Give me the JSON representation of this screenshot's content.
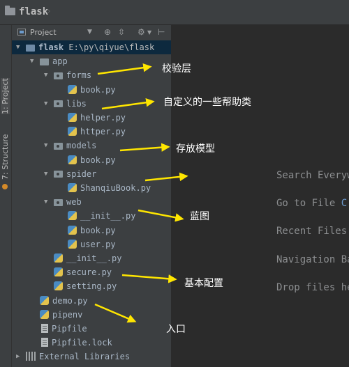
{
  "breadcrumb": {
    "title": "flask"
  },
  "tool_windows": {
    "project_tab": "1: Project",
    "structure_tab": "7: Structure"
  },
  "project_panel": {
    "view_label": "Project",
    "toolbar_icons": [
      "chevron-down-icon",
      "target-icon",
      "collapse-icon",
      "gear-icon",
      "hide-icon"
    ]
  },
  "tree": [
    {
      "label": "flask",
      "path": "E:\\py\\qiyue\\flask",
      "depth": 0,
      "type": "project",
      "expanded": true
    },
    {
      "label": "app",
      "depth": 1,
      "type": "folder",
      "expanded": true
    },
    {
      "label": "forms",
      "depth": 2,
      "type": "package",
      "expanded": true
    },
    {
      "label": "book.py",
      "depth": 3,
      "type": "python"
    },
    {
      "label": "libs",
      "depth": 2,
      "type": "package",
      "expanded": true
    },
    {
      "label": "helper.py",
      "depth": 3,
      "type": "python"
    },
    {
      "label": "httper.py",
      "depth": 3,
      "type": "python"
    },
    {
      "label": "models",
      "depth": 2,
      "type": "package",
      "expanded": true
    },
    {
      "label": "book.py",
      "depth": 3,
      "type": "python"
    },
    {
      "label": "spider",
      "depth": 2,
      "type": "package",
      "expanded": true
    },
    {
      "label": "ShanqiuBook.py",
      "depth": 3,
      "type": "python"
    },
    {
      "label": "web",
      "depth": 2,
      "type": "package",
      "expanded": true
    },
    {
      "label": "__init__.py",
      "depth": 3,
      "type": "python"
    },
    {
      "label": "book.py",
      "depth": 3,
      "type": "python"
    },
    {
      "label": "user.py",
      "depth": 3,
      "type": "python"
    },
    {
      "label": "__init__.py",
      "depth": 2,
      "type": "python"
    },
    {
      "label": "secure.py",
      "depth": 2,
      "type": "python"
    },
    {
      "label": "setting.py",
      "depth": 2,
      "type": "python"
    },
    {
      "label": "demo.py",
      "depth": 1,
      "type": "python"
    },
    {
      "label": "pipenv",
      "depth": 1,
      "type": "python"
    },
    {
      "label": "Pipfile",
      "depth": 1,
      "type": "file"
    },
    {
      "label": "Pipfile.lock",
      "depth": 1,
      "type": "file"
    },
    {
      "label": "External Libraries",
      "depth": 0,
      "type": "library",
      "expanded": false
    }
  ],
  "editor_hints": [
    {
      "text": "Search Everyw"
    },
    {
      "text": "Go to File",
      "key": "C"
    },
    {
      "text": "Recent Files"
    },
    {
      "text": "Navigation Ba"
    },
    {
      "text": "Drop files he"
    }
  ],
  "annotations": [
    {
      "text": "校验层"
    },
    {
      "text": "自定义的一些帮助类"
    },
    {
      "text": "存放模型"
    },
    {
      "text": ""
    },
    {
      "text": "蓝图"
    },
    {
      "text": "基本配置"
    },
    {
      "text": "入口"
    }
  ],
  "colors": {
    "annotation_arrow": "#ffe600",
    "selection": "#0d293e",
    "panel_bg": "#3c3f41",
    "editor_bg": "#2b2b2b"
  }
}
